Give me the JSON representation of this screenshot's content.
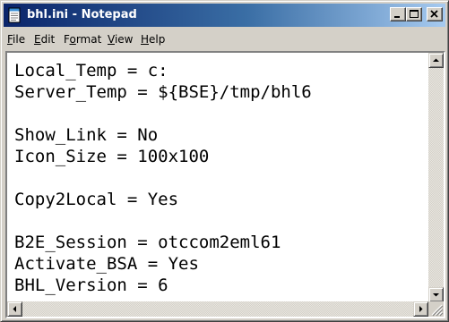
{
  "window": {
    "title": "bhl.ini - Notepad",
    "app_icon": "notepad-icon",
    "controls": {
      "minimize_icon": "minimize-icon",
      "maximize_icon": "maximize-icon",
      "close_icon": "close-icon"
    }
  },
  "menu": {
    "items": [
      {
        "mnemonic": "F",
        "rest": "ile",
        "label": "File"
      },
      {
        "mnemonic": "E",
        "rest": "dit",
        "label": "Edit"
      },
      {
        "pre": "F",
        "mnemonic": "o",
        "rest": "rmat",
        "label": "Format"
      },
      {
        "mnemonic": "V",
        "rest": "iew",
        "label": "View"
      },
      {
        "mnemonic": "H",
        "rest": "elp",
        "label": "Help"
      }
    ]
  },
  "editor": {
    "lines": [
      "Local_Temp = c:",
      "Server_Temp = ${BSE}/tmp/bhl6",
      "",
      "Show_Link = No",
      "Icon_Size = 100x100",
      "",
      "Copy2Local = Yes",
      "",
      "B2E_Session = otccom2eml61",
      "Activate_BSA = Yes",
      "BHL_Version = 6"
    ]
  },
  "colors": {
    "titlebar_start": "#0a246a",
    "titlebar_end": "#a6caf0",
    "face": "#d4d0c8"
  }
}
